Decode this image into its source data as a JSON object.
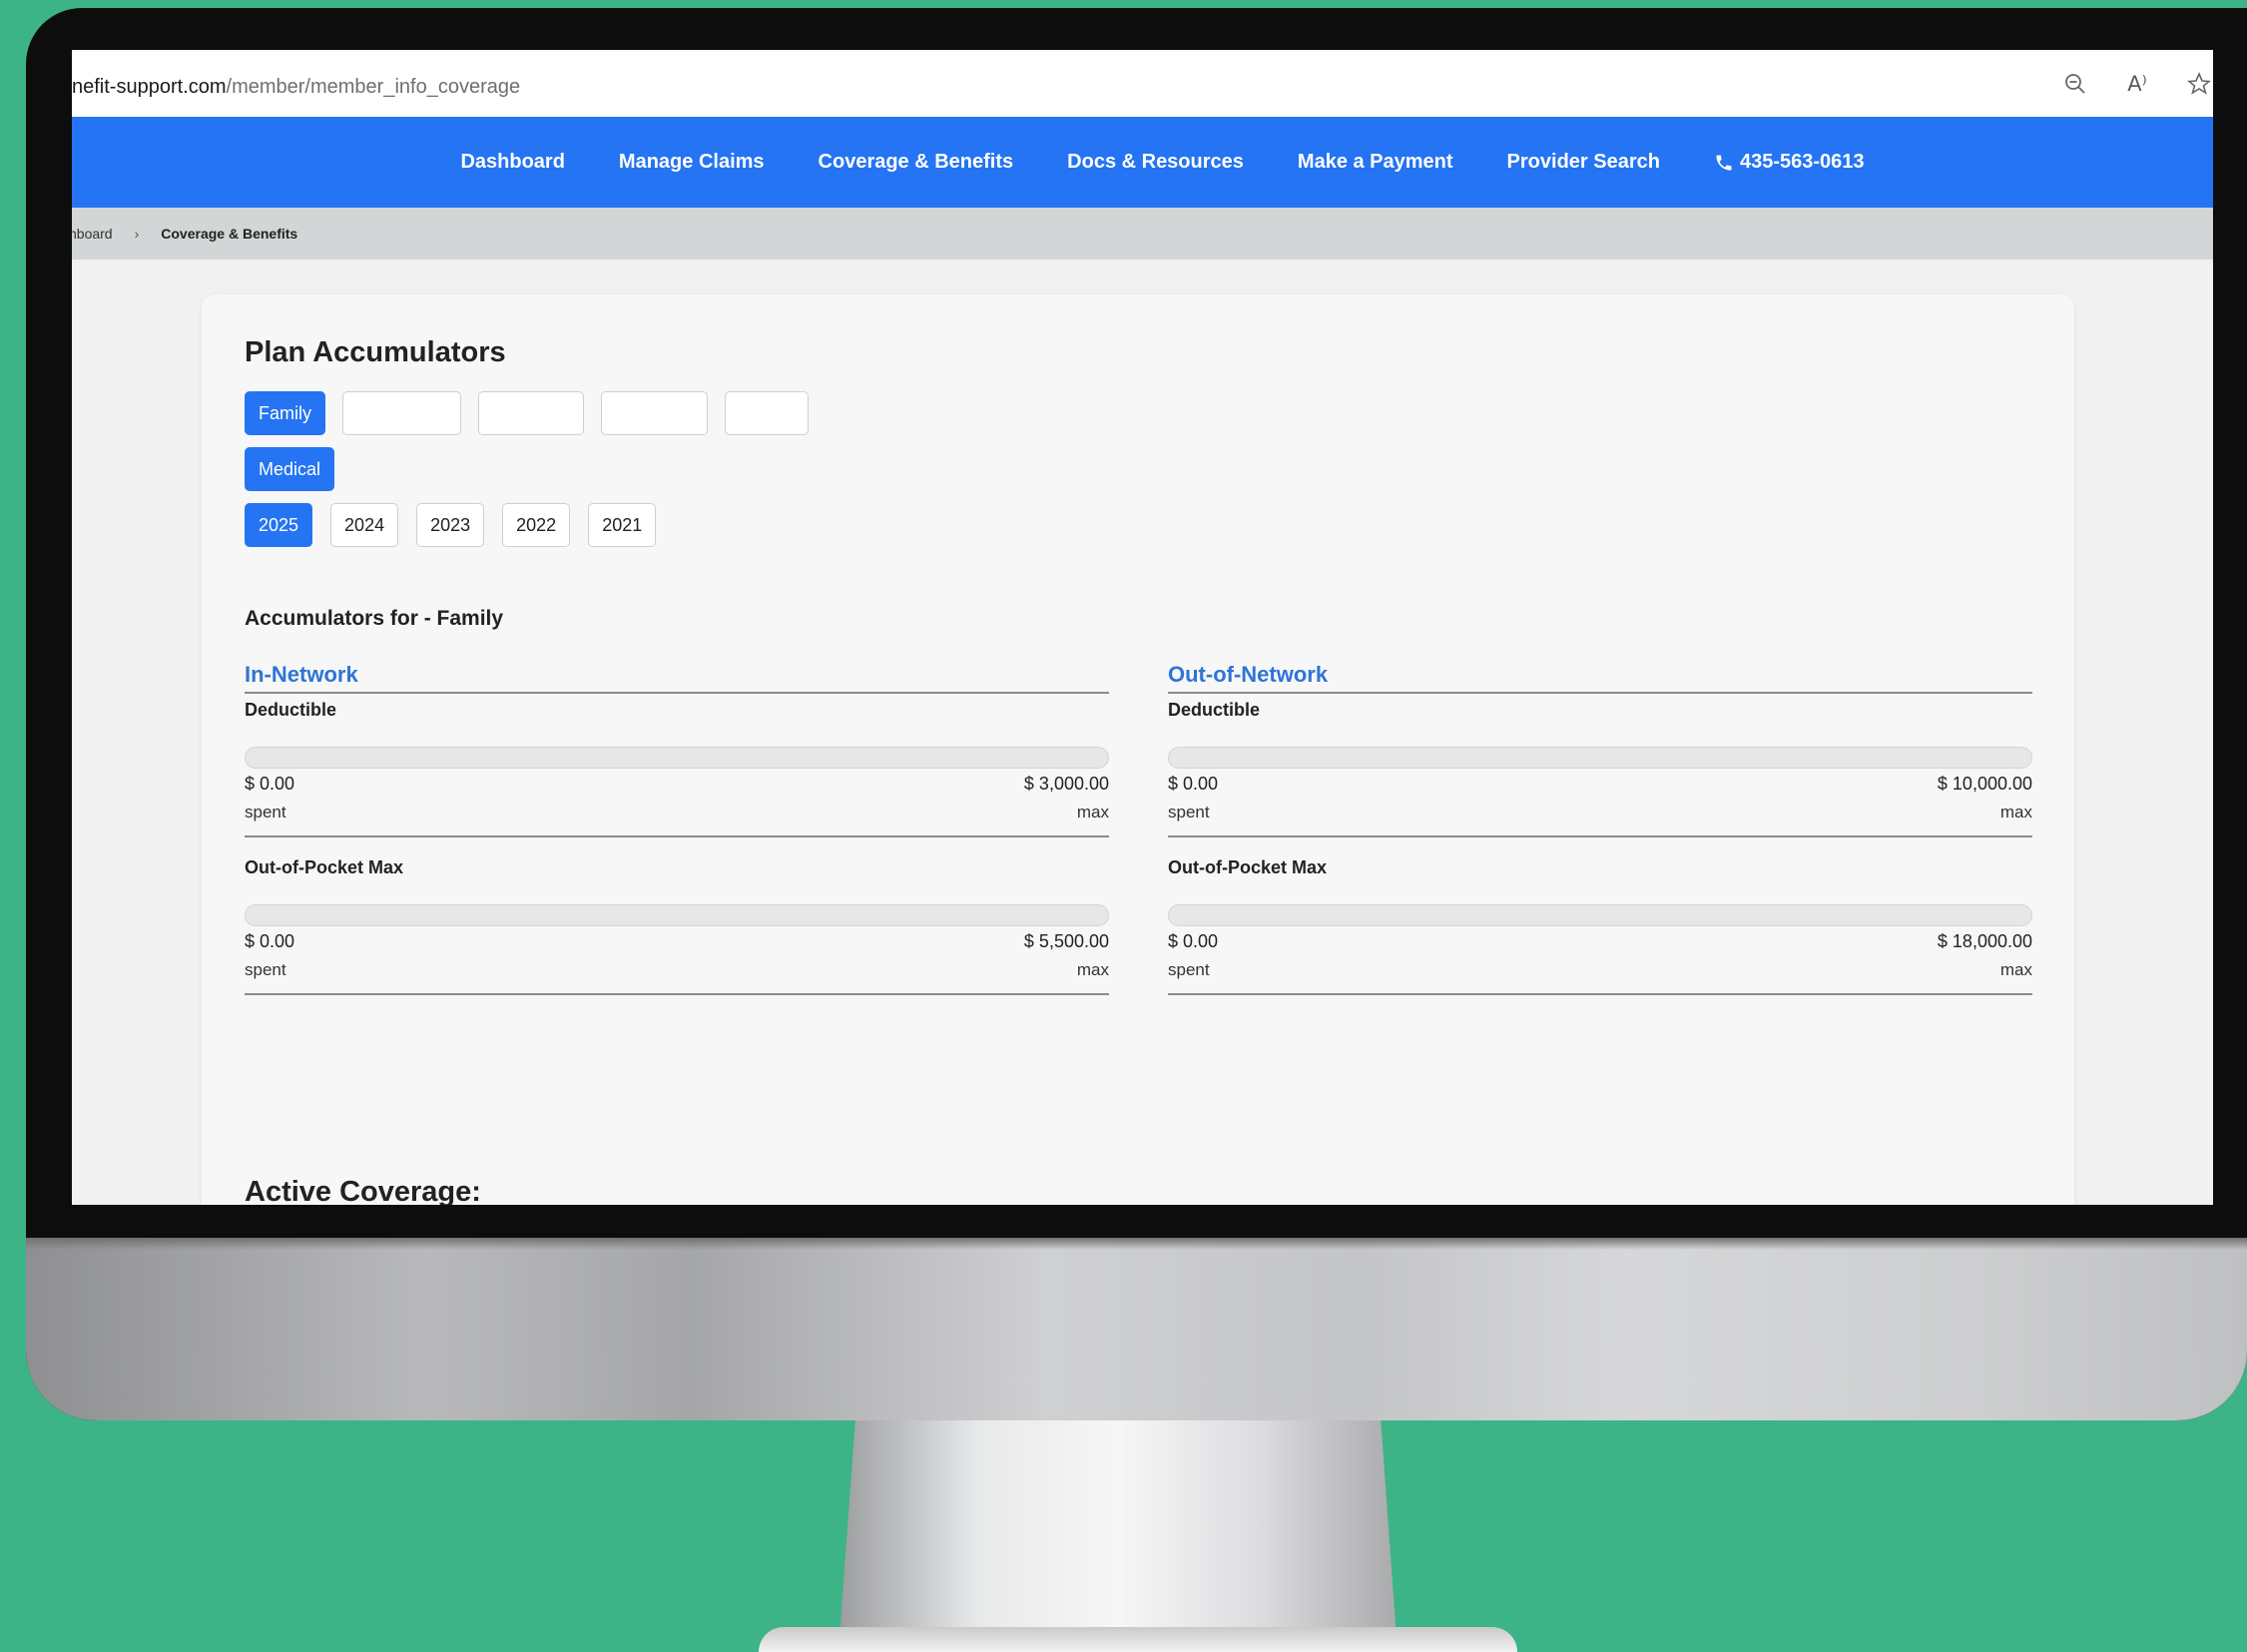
{
  "browser": {
    "url_host": "nefit-support.com",
    "url_path": "/member/member_info_coverage",
    "icons": [
      "zoom-out-icon",
      "read-aloud-icon",
      "favorite-star-icon"
    ],
    "read_aloud_glyph": "A⁾"
  },
  "nav": {
    "links": [
      "Dashboard",
      "Manage Claims",
      "Coverage & Benefits",
      "Docs & Resources",
      "Make a Payment",
      "Provider Search"
    ],
    "phone": "435-563-0613",
    "phone_icon": "phone-icon",
    "bg_color": "#2474f3"
  },
  "breadcrumb": {
    "first": "shboard",
    "separator": "›",
    "current": "Coverage & Benefits"
  },
  "accumulators": {
    "title": "Plan Accumulators",
    "members": [
      {
        "label": "Family",
        "active": true
      },
      {
        "label": "",
        "active": false
      },
      {
        "label": "",
        "active": false
      },
      {
        "label": "",
        "active": false
      },
      {
        "label": "",
        "active": false
      }
    ],
    "types": [
      {
        "label": "Medical",
        "active": true
      }
    ],
    "years": [
      {
        "label": "2025",
        "active": true
      },
      {
        "label": "2024",
        "active": false
      },
      {
        "label": "2023",
        "active": false
      },
      {
        "label": "2022",
        "active": false
      },
      {
        "label": "2021",
        "active": false
      }
    ],
    "heading": "Accumulators for - Family",
    "in_network": {
      "title": "In-Network",
      "deductible": {
        "label": "Deductible",
        "spent": "$ 0.00",
        "max": "$ 3,000.00",
        "spent_caption": "spent",
        "max_caption": "max",
        "progress": 0
      },
      "oop": {
        "label": "Out-of-Pocket Max",
        "spent": "$ 0.00",
        "max": "$ 5,500.00",
        "spent_caption": "spent",
        "max_caption": "max",
        "progress": 0
      }
    },
    "out_network": {
      "title": "Out-of-Network",
      "deductible": {
        "label": "Deductible",
        "spent": "$ 0.00",
        "max": "$ 10,000.00",
        "spent_caption": "spent",
        "max_caption": "max",
        "progress": 0
      },
      "oop": {
        "label": "Out-of-Pocket Max",
        "spent": "$ 0.00",
        "max": "$ 18,000.00",
        "spent_caption": "spent",
        "max_caption": "max",
        "progress": 0
      }
    }
  },
  "active_coverage": {
    "title": "Active Coverage:"
  },
  "colors": {
    "accent": "#2474f3",
    "link": "#2f74d6",
    "background": "#3db487"
  }
}
